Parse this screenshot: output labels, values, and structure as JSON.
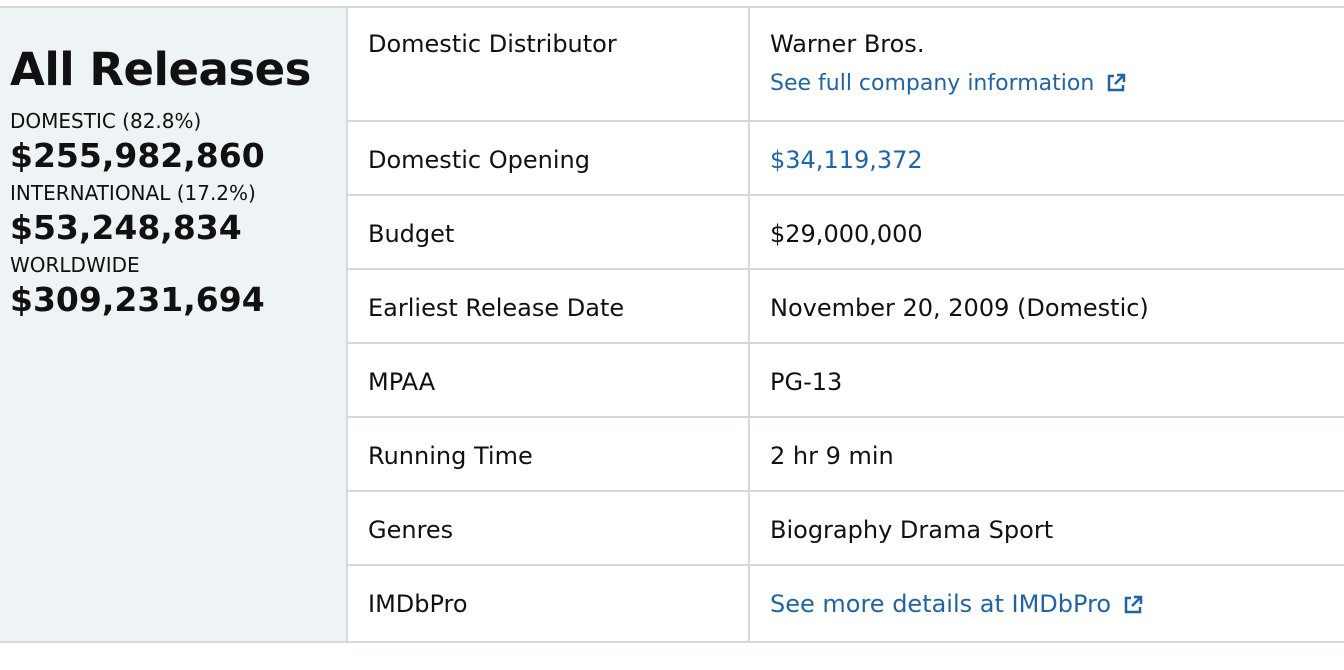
{
  "summary": {
    "title": "All Releases",
    "domestic_label": "DOMESTIC (82.8%)",
    "domestic_value": "$255,982,860",
    "international_label": "INTERNATIONAL (17.2%)",
    "international_value": "$53,248,834",
    "worldwide_label": "WORLDWIDE",
    "worldwide_value": "$309,231,694"
  },
  "details": {
    "distributor_label": "Domestic Distributor",
    "distributor_value": "Warner Bros.",
    "distributor_link": "See full company information",
    "opening_label": "Domestic Opening",
    "opening_value": "$34,119,372",
    "budget_label": "Budget",
    "budget_value": "$29,000,000",
    "release_label": "Earliest Release Date",
    "release_value": "November 20, 2009 (Domestic)",
    "mpaa_label": "MPAA",
    "mpaa_value": "PG-13",
    "runtime_label": "Running Time",
    "runtime_value": "2 hr 9 min",
    "genres_label": "Genres",
    "genres_value": "Biography Drama Sport",
    "imdbpro_label": "IMDbPro",
    "imdbpro_link": "See more details at IMDbPro"
  },
  "colors": {
    "link": "#1f64a6",
    "panel": "#eef3f6",
    "border": "#d5d9d9"
  },
  "icons": {
    "external": "external-link-icon"
  }
}
